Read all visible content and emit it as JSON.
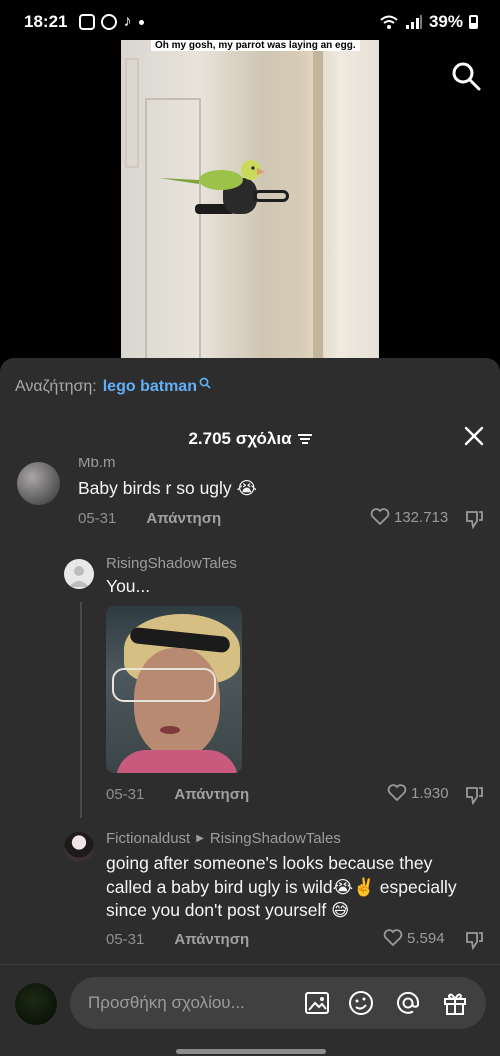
{
  "status_bar": {
    "time": "18:21",
    "battery": "39%",
    "notification_icons": [
      "instagram-icon",
      "panda-icon",
      "tiktok-icon"
    ]
  },
  "video": {
    "caption": "Oh my gosh, my parrot was laying an egg."
  },
  "search_suggestion": {
    "label": "Αναζήτηση:",
    "query": "lego batman"
  },
  "comments_header": {
    "title": "2.705 σχόλια"
  },
  "comments": [
    {
      "username": "Mb.m",
      "text": "Baby birds r so ugly 😭",
      "date": "05-31",
      "reply_label": "Απάντηση",
      "likes": "132.713"
    },
    {
      "username": "RisingShadowTales",
      "text": "You...",
      "date": "05-31",
      "reply_label": "Απάντηση",
      "likes": "1.930"
    },
    {
      "username": "Fictionaldust",
      "reply_to": "RisingShadowTales",
      "text": "going after someone's looks because they called a baby bird ugly is wild😭✌️ especially since you don't post yourself 😅",
      "date": "05-31",
      "reply_label": "Απάντηση",
      "likes": "5.594"
    }
  ],
  "input_bar": {
    "placeholder": "Προσθήκη σχολίου..."
  },
  "colors": {
    "sheet_bg": "#2d2d2d",
    "accent_link": "#61aff6",
    "muted_text": "#9c9c9c"
  }
}
